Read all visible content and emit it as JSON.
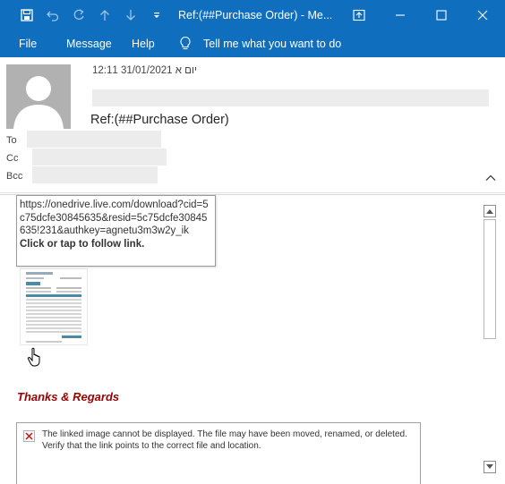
{
  "window": {
    "title": "Ref:(##Purchase Order)  -  Me...",
    "accent_color": "#106ebe"
  },
  "menu": {
    "file": "File",
    "message": "Message",
    "help": "Help",
    "tell_me": "Tell me what you want to do"
  },
  "header": {
    "date": "יום א 31/01/2021 12:11",
    "subject": "Ref:(##Purchase Order)",
    "to_label": "To",
    "cc_label": "Cc",
    "bcc_label": "Bcc"
  },
  "body": {
    "tooltip_url": "https://onedrive.live.com/download?cid=5c75dcfe30845635&resid=5c75dcfe30845635!231&authkey=agnetu3m3w2y_ik",
    "tooltip_action": "Click or tap to follow link.",
    "thanks": "Thanks & Regards",
    "broken_image_message": "The linked image cannot be displayed.  The file may have been moved, renamed, or deleted. Verify that the link points to the correct file and location."
  }
}
